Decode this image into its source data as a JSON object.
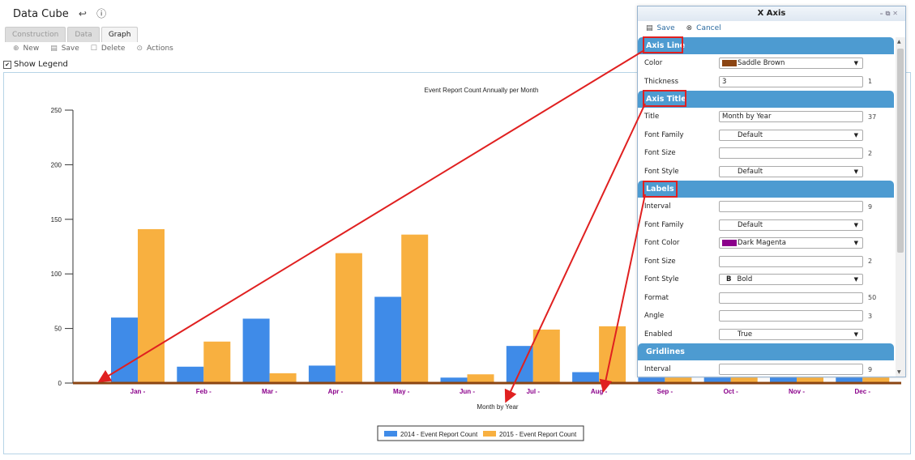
{
  "app": {
    "title": "Data Cube"
  },
  "tabs": [
    "Construction",
    "Data",
    "Graph"
  ],
  "toolbar": {
    "new": "New",
    "save": "Save",
    "delete": "Delete",
    "actions": "Actions"
  },
  "show_legend": "Show Legend",
  "chart_data": {
    "type": "bar",
    "title": "Event Report Count Annually per Month",
    "xlabel": "Month by Year",
    "ylabel": "",
    "ylim": [
      0,
      250
    ],
    "yticks": [
      0,
      50,
      100,
      150,
      200,
      250
    ],
    "categories": [
      "Jan -",
      "Feb -",
      "Mar -",
      "Apr -",
      "May -",
      "Jun -",
      "Jul -",
      "Aug -",
      "Sep -",
      "Oct -",
      "Nov -",
      "Dec -"
    ],
    "series": [
      {
        "name": "2014 - Event Report Count",
        "color": "#3f8be8",
        "values": [
          60,
          15,
          59,
          16,
          79,
          5,
          34,
          10,
          5,
          5,
          5,
          5
        ]
      },
      {
        "name": "2015 - Event Report Count",
        "color": "#f8b040",
        "values": [
          141,
          38,
          9,
          119,
          136,
          8,
          49,
          52,
          5,
          5,
          5,
          5
        ]
      }
    ],
    "axis_line_color": "#8b4513",
    "label_color": "#8b008b",
    "legend_position": "bottom-center"
  },
  "dialog": {
    "title": "X Axis",
    "save": "Save",
    "cancel": "Cancel",
    "sections": {
      "axis_line": "Axis Line",
      "axis_title": "Axis Title",
      "labels": "Labels",
      "gridlines": "Gridlines"
    },
    "axis_line": {
      "color_label": "Color",
      "color_value": "Saddle Brown",
      "color_hex": "#8b4513",
      "thickness_label": "Thickness",
      "thickness_value": "3",
      "thickness_num": "1"
    },
    "axis_title": {
      "title_label": "Title",
      "title_value": "Month by Year",
      "title_num": "37",
      "font_family_label": "Font Family",
      "font_family_value": "Default",
      "font_size_label": "Font Size",
      "font_size_value": "",
      "font_size_num": "2",
      "font_style_label": "Font Style",
      "font_style_value": "Default"
    },
    "labels": {
      "interval_label": "Interval",
      "interval_value": "",
      "interval_num": "9",
      "font_family_label": "Font Family",
      "font_family_value": "Default",
      "font_color_label": "Font Color",
      "font_color_value": "Dark Magenta",
      "font_color_hex": "#8b008b",
      "font_size_label": "Font Size",
      "font_size_value": "",
      "font_size_num": "2",
      "font_style_label": "Font Style",
      "font_style_value": "Bold",
      "font_style_glyph": "B",
      "format_label": "Format",
      "format_value": "",
      "format_num": "50",
      "angle_label": "Angle",
      "angle_value": "",
      "angle_num": "3",
      "enabled_label": "Enabled",
      "enabled_value": "True"
    },
    "gridlines": {
      "interval_label": "Interval",
      "interval_num": "9"
    }
  }
}
